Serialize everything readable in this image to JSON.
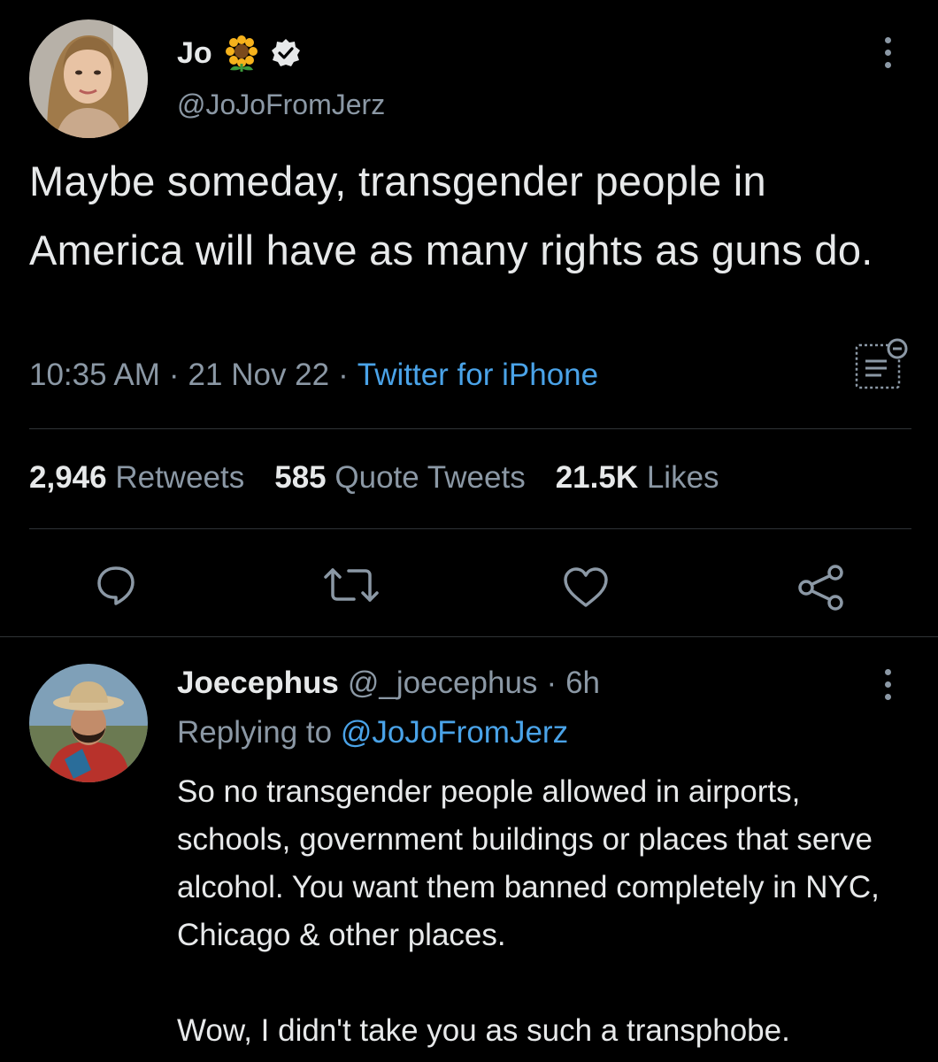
{
  "tweet": {
    "display_name": "Jo",
    "name_emoji": "🌻",
    "handle": "@JoJoFromJerz",
    "text": "Maybe someday, transgender people in America will have as many rights as guns do.",
    "time": "10:35 AM",
    "separator": "·",
    "date": "21 Nov 22",
    "source": "Twitter for iPhone",
    "stats": {
      "retweets_count": "2,946",
      "retweets_label": "Retweets",
      "quotes_count": "585",
      "quotes_label": "Quote Tweets",
      "likes_count": "21.5K",
      "likes_label": "Likes"
    },
    "actions": [
      "reply-icon",
      "retweet-icon",
      "like-icon",
      "share-icon"
    ]
  },
  "reply": {
    "display_name": "Joecephus",
    "handle": "@_joecephus",
    "separator": "·",
    "time": "6h",
    "replying_label": "Replying to",
    "replying_handle": "@JoJoFromJerz",
    "text_p1": "So no transgender people allowed in airports, schools, government buildings or places that serve alcohol. You want them banned completely in NYC, Chicago & other places.",
    "text_p2": "Wow, I didn't take you as such a transphobe."
  },
  "colors": {
    "background": "#000000",
    "text": "#e7e9ea",
    "muted": "#8b98a5",
    "link": "#4aa3e8",
    "divider": "#2f3336"
  }
}
